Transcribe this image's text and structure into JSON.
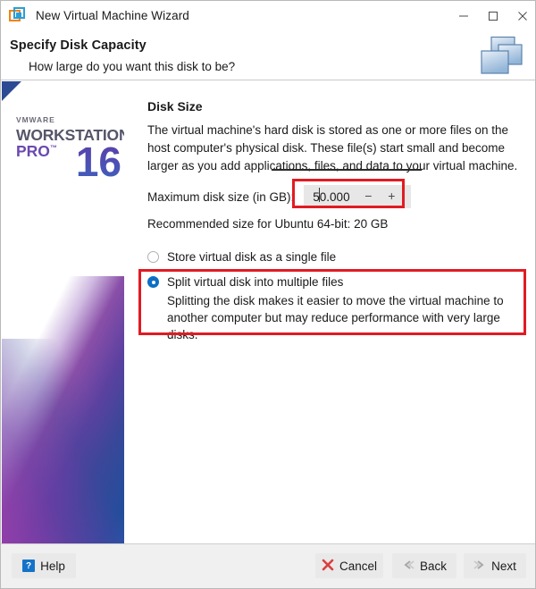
{
  "window": {
    "title": "New Virtual Machine Wizard",
    "icon": "vmware-logo-icon",
    "controls": {
      "minimize": "minimize-icon",
      "maximize": "maximize-icon",
      "close": "close-icon"
    }
  },
  "header": {
    "title": "Specify Disk Capacity",
    "subtitle": "How large do you want this disk to be?",
    "graphic": "stacked-disks-icon"
  },
  "sidebar": {
    "brand_vendor": "VMWARE",
    "brand_product": "WORKSTATION",
    "brand_edition": "PRO",
    "brand_trademark": "™",
    "brand_version": "16"
  },
  "main": {
    "section_heading": "Disk Size",
    "description": "The virtual machine's hard disk is stored as one or more files on the host computer's physical disk. These file(s) start small and become larger as you add applications, files, and data to your virtual machine.",
    "max_size_label": "Maximum disk size (in GB):",
    "max_size_value": "50.000",
    "spinner_decrement": "−",
    "spinner_increment": "+",
    "recommended": "Recommended size for Ubuntu 64-bit: 20 GB",
    "radio_options": [
      {
        "label": "Store virtual disk as a single file",
        "selected": false,
        "description": ""
      },
      {
        "label": "Split virtual disk into multiple files",
        "selected": true,
        "description": "Splitting the disk makes it easier to move the virtual machine to another computer but may reduce performance with very large disks."
      }
    ]
  },
  "annotations": {
    "highlight_color": "#e11b22",
    "boxes": [
      "max-disk-size-spinner",
      "split-virtual-disk-option"
    ]
  },
  "footer": {
    "help_label": "Help",
    "help_icon": "question-mark-icon",
    "cancel_label": "Cancel",
    "cancel_icon": "red-x-icon",
    "back_label": "Back",
    "back_icon": "chevron-left-icon",
    "next_label": "Next",
    "next_icon": "chevron-right-icon"
  }
}
